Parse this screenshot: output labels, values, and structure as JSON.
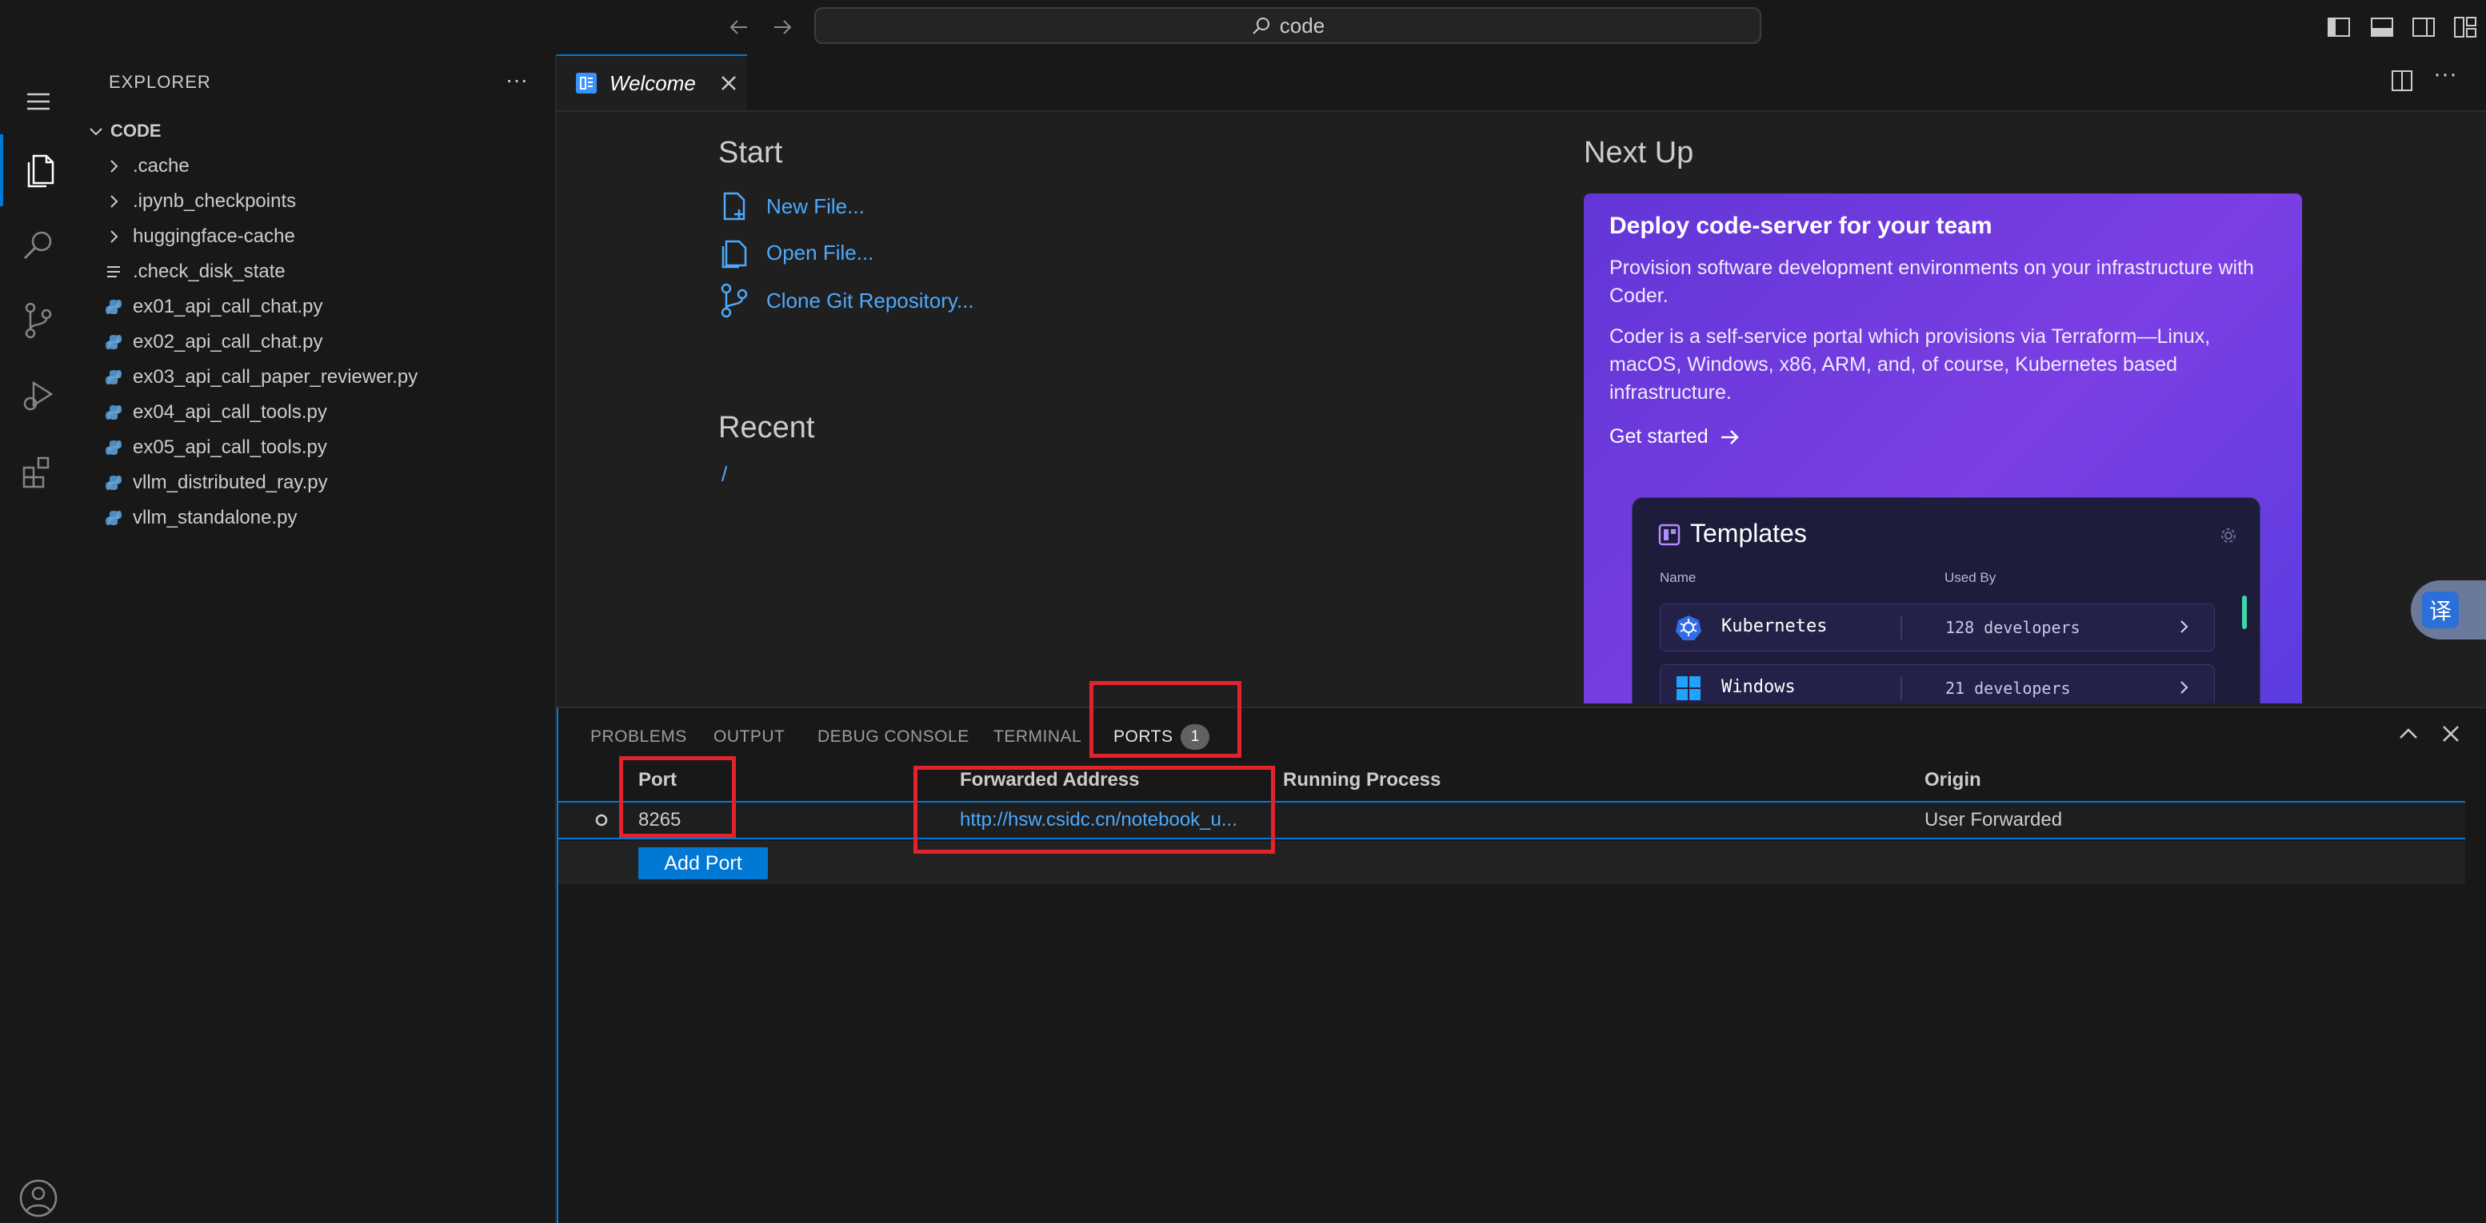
{
  "titlebar": {
    "command_center_text": "code"
  },
  "sidebar": {
    "title": "EXPLORER",
    "more_glyph": "···",
    "folder": "CODE",
    "items": [
      {
        "label": ".cache",
        "kind": "folder"
      },
      {
        "label": ".ipynb_checkpoints",
        "kind": "folder"
      },
      {
        "label": "huggingface-cache",
        "kind": "folder"
      },
      {
        "label": ".check_disk_state",
        "kind": "text-file"
      },
      {
        "label": "ex01_api_call_chat.py",
        "kind": "python-file"
      },
      {
        "label": "ex02_api_call_chat.py",
        "kind": "python-file"
      },
      {
        "label": "ex03_api_call_paper_reviewer.py",
        "kind": "python-file"
      },
      {
        "label": "ex04_api_call_tools.py",
        "kind": "python-file"
      },
      {
        "label": "ex05_api_call_tools.py",
        "kind": "python-file"
      },
      {
        "label": "vllm_distributed_ray.py",
        "kind": "python-file"
      },
      {
        "label": "vllm_standalone.py",
        "kind": "python-file"
      }
    ]
  },
  "editor": {
    "tab_label": "Welcome",
    "start": {
      "title": "Start",
      "links": [
        "New File...",
        "Open File...",
        "Clone Git Repository..."
      ]
    },
    "recent": {
      "title": "Recent",
      "items": [
        "/"
      ]
    },
    "next_up": {
      "title": "Next Up",
      "card_title": "Deploy code-server for your team",
      "desc1": "Provision software development environments on your infrastructure with Coder.",
      "desc2": "Coder is a self-service portal which provisions via Terraform—Linux, macOS, Windows, x86, ARM, and, of course, Kubernetes based infrastructure.",
      "cta": "Get started",
      "templates": {
        "title": "Templates",
        "col_name": "Name",
        "col_used_by": "Used By",
        "rows": [
          {
            "name": "Kubernetes",
            "used_by": "128 developers"
          },
          {
            "name": "Windows",
            "used_by": "21 developers"
          }
        ]
      }
    }
  },
  "panel": {
    "tabs": [
      "PROBLEMS",
      "OUTPUT",
      "DEBUG CONSOLE",
      "TERMINAL",
      "PORTS"
    ],
    "ports_badge": "1",
    "columns": [
      "Port",
      "Forwarded Address",
      "Running Process",
      "Origin"
    ],
    "rows": [
      {
        "port": "8265",
        "address": "http://hsw.csidc.cn/notebook_u...",
        "process": "",
        "origin": "User Forwarded"
      }
    ],
    "add_port_label": "Add Port"
  },
  "translate_widget": {
    "glyph": "译"
  },
  "colors": {
    "accent": "#0078d4",
    "link": "#4daafc",
    "highlight_box": "#e3232b",
    "card_purple": "#6a3adb"
  }
}
